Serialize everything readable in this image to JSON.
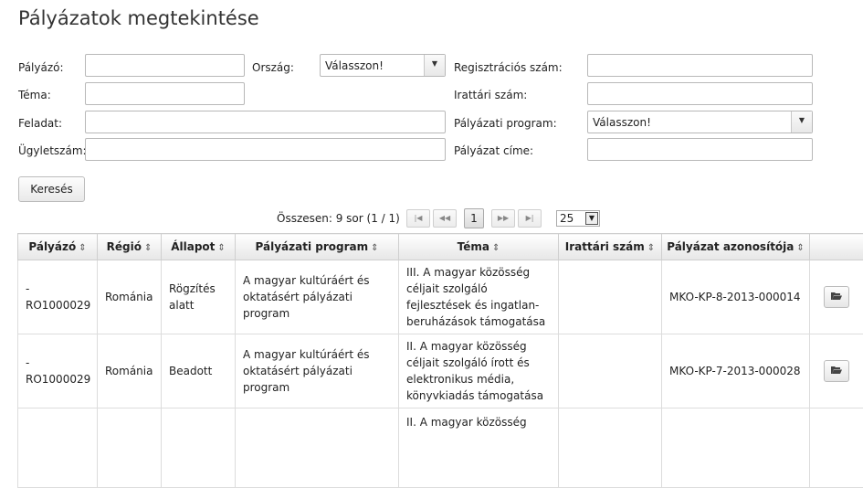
{
  "page": {
    "title": "Pályázatok megtekintése"
  },
  "form": {
    "palyazo_label": "Pályázó:",
    "orszag_label": "Ország:",
    "orszag_value": "Válasszon!",
    "reg_label": "Regisztrációs szám:",
    "tema_label": "Téma:",
    "iratt_label": "Irattári szám:",
    "feladat_label": "Feladat:",
    "program_label": "Pályázati program:",
    "program_value": "Válasszon!",
    "ugyletszam_label": "Ügyletszám:",
    "cime_label": "Pályázat címe:",
    "search_button": "Keresés"
  },
  "pager": {
    "summary": "Összesen: 9 sor (1 / 1)",
    "first": "|◀",
    "prev": "◀◀",
    "current": "1",
    "next": "▶▶",
    "last": "▶|",
    "per_page": "25"
  },
  "table": {
    "headers": [
      "Pályázó",
      "Régió",
      "Állapot",
      "Pályázati program",
      "Téma",
      "Irattári szám",
      "Pályázat azonosítója"
    ],
    "rows": [
      {
        "applicant": "- RO1000029",
        "region": "Románia",
        "status": "Rögzítés alatt",
        "program": "A magyar kultúráért és oktatásért pályázati program",
        "topic": "III. A magyar közösség céljait szolgáló fejlesztések és ingatlan-beruházások támogatása",
        "archive": "",
        "id": "MKO-KP-8-2013-000014"
      },
      {
        "applicant": "- RO1000029",
        "region": "Románia",
        "status": "Beadott",
        "program": "A magyar kultúráért és oktatásért pályázati program",
        "topic": "II. A magyar közösség céljait szolgáló írott és elektronikus média, könyvkiadás támogatása",
        "archive": "",
        "id": "MKO-KP-7-2013-000028"
      },
      {
        "applicant": "",
        "region": "",
        "status": "",
        "program": "",
        "topic": "II. A magyar közösség",
        "archive": "",
        "id": ""
      }
    ]
  },
  "icons": {
    "sort": "sort-updown-icon",
    "open": "folder-open-icon",
    "dropdown": "triangle-down-icon"
  }
}
